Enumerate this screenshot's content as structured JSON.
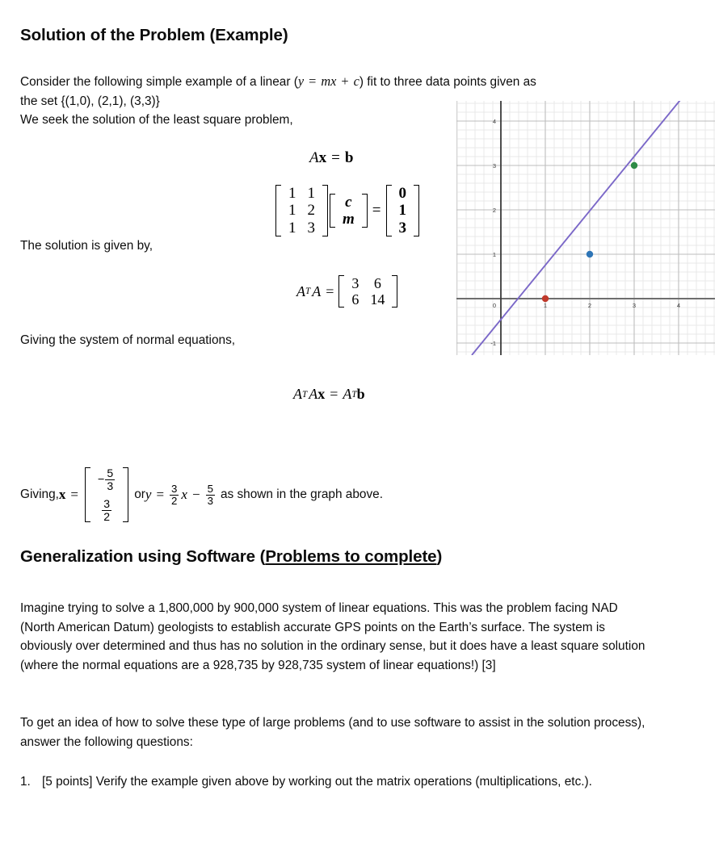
{
  "document": {
    "heading1": "Solution of the Problem (Example)",
    "heading2_main": "Generalization using Software (",
    "heading2_underlined": "Problems to complete",
    "heading2_tail": ")",
    "intro_line1_a": "Consider the following simple example of a linear (",
    "intro_line1_math": "y = mx + c",
    "intro_line1_b": ") fit to three data points given as",
    "intro_line2": "the set {(1,0), (2,1), (3,3)}",
    "intro_line3": " We seek the solution of the least square problem,",
    "solution_label": "The solution is given by,",
    "normal_eq_label": "Giving the system of normal equations,",
    "giving_label": "Giving, ",
    "giving_or": "or ",
    "giving_tail": "as shown in the graph above.",
    "para_generalization": "Imagine trying to solve a 1,800,000 by 900,000 system of linear equations. This was the problem facing NAD (North American Datum) geologists to establish accurate GPS points on the Earth’s surface. The system is obviously over determined and thus has no solution in the ordinary sense, but it does have a least square solution (where the normal equations are a 928,735 by 928,735 system of linear equations!) [3]",
    "para_questions": "To get an idea of how to solve these type of large problems (and to use software to assist in the solution process), answer the following questions:",
    "list": [
      {
        "number": "1.",
        "text": "[5 points] Verify the example given above by working out the matrix operations (multiplications, etc.)."
      }
    ]
  },
  "equations": {
    "ax_b": {
      "A": "A",
      "x": "x",
      "eq": "=",
      "b": "b"
    },
    "matrix_system": {
      "A_values": [
        "1",
        "1",
        "1",
        "2",
        "1",
        "3"
      ],
      "unknowns": [
        "c",
        "m"
      ],
      "eq": "=",
      "b_values": [
        "0",
        "1",
        "3"
      ]
    },
    "ata": {
      "lhs_A": "A",
      "lhs_T": "T",
      "lhs_A2": "A",
      "eq": "=",
      "values": [
        "3",
        "6",
        "6",
        "14"
      ]
    },
    "normal": {
      "A": "A",
      "T": "T",
      "A2": "A",
      "x": "x",
      "eq": "=",
      "A3": "A",
      "T2": "T",
      "b": "b"
    },
    "solution_vector": {
      "row1_sign": "−",
      "row1_num": "5",
      "row1_den": "3",
      "row2_num": "3",
      "row2_den": "2"
    },
    "line_equation": {
      "y": "y",
      "eq": "=",
      "slope_num": "3",
      "slope_den": "2",
      "x": "x",
      "minus": "−",
      "int_num": "5",
      "int_den": "3"
    }
  },
  "chart_data": {
    "type": "scatter",
    "title": "",
    "xlabel": "",
    "ylabel": "",
    "xlim": [
      -1.0,
      4.8
    ],
    "ylim": [
      -1.35,
      4.55
    ],
    "xticks": [
      0,
      1,
      2,
      3,
      4
    ],
    "xtick_labels": [
      "0",
      "1",
      "2",
      "3",
      "4"
    ],
    "yticks": [
      -1,
      1,
      2,
      3,
      4
    ],
    "ytick_labels": [
      "-1",
      "1",
      "2",
      "3",
      "4"
    ],
    "y_zero_label": "0",
    "grid": true,
    "minor_grid": true,
    "minor_step": 0.2,
    "major_step": 1,
    "axis_color": "#808080",
    "grid_major_color": "#bfbfbf",
    "grid_minor_color": "#e8e8e8",
    "points": [
      {
        "x": 1,
        "y": 0,
        "color": "#c0392b",
        "label": "(1,0)"
      },
      {
        "x": 2,
        "y": 1,
        "color": "#2e75b6",
        "label": "(2,1)"
      },
      {
        "x": 3,
        "y": 3,
        "color": "#2e8b46",
        "label": "(3,3)"
      }
    ],
    "line": {
      "expression": "y = 1.5x - 1.6667",
      "slope": 1.5,
      "intercept": -1.6667,
      "color": "#7b68c8",
      "width": 1.8
    }
  }
}
